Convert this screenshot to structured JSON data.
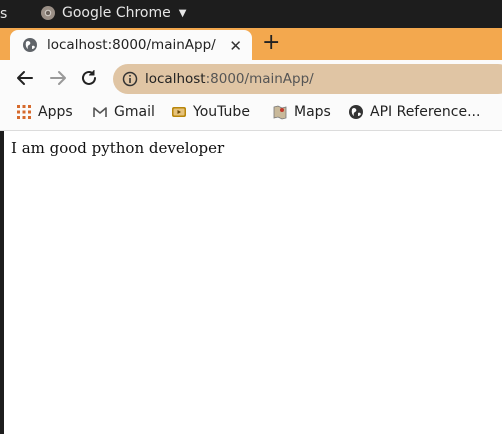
{
  "system_bar": {
    "left_fragment": "s",
    "app_name": "Google Chrome"
  },
  "tab": {
    "title": "localhost:8000/mainApp/",
    "close": "✕",
    "new_tab": "+"
  },
  "address_bar": {
    "host": "localhost",
    "rest": ":8000/mainApp/"
  },
  "bookmarks": [
    {
      "label": "Apps",
      "icon": "apps-grid-icon"
    },
    {
      "label": "Gmail",
      "icon": "gmail-icon"
    },
    {
      "label": "YouTube",
      "icon": "youtube-icon"
    },
    {
      "label": "Maps",
      "icon": "maps-icon"
    },
    {
      "label": "API Reference...",
      "icon": "globe-icon"
    }
  ],
  "page": {
    "body_text": "I am good python developer"
  },
  "colors": {
    "tab_strip": "#f3a84e",
    "omnibox": "#e0c5a4",
    "system_bar": "#1d1d1d"
  }
}
